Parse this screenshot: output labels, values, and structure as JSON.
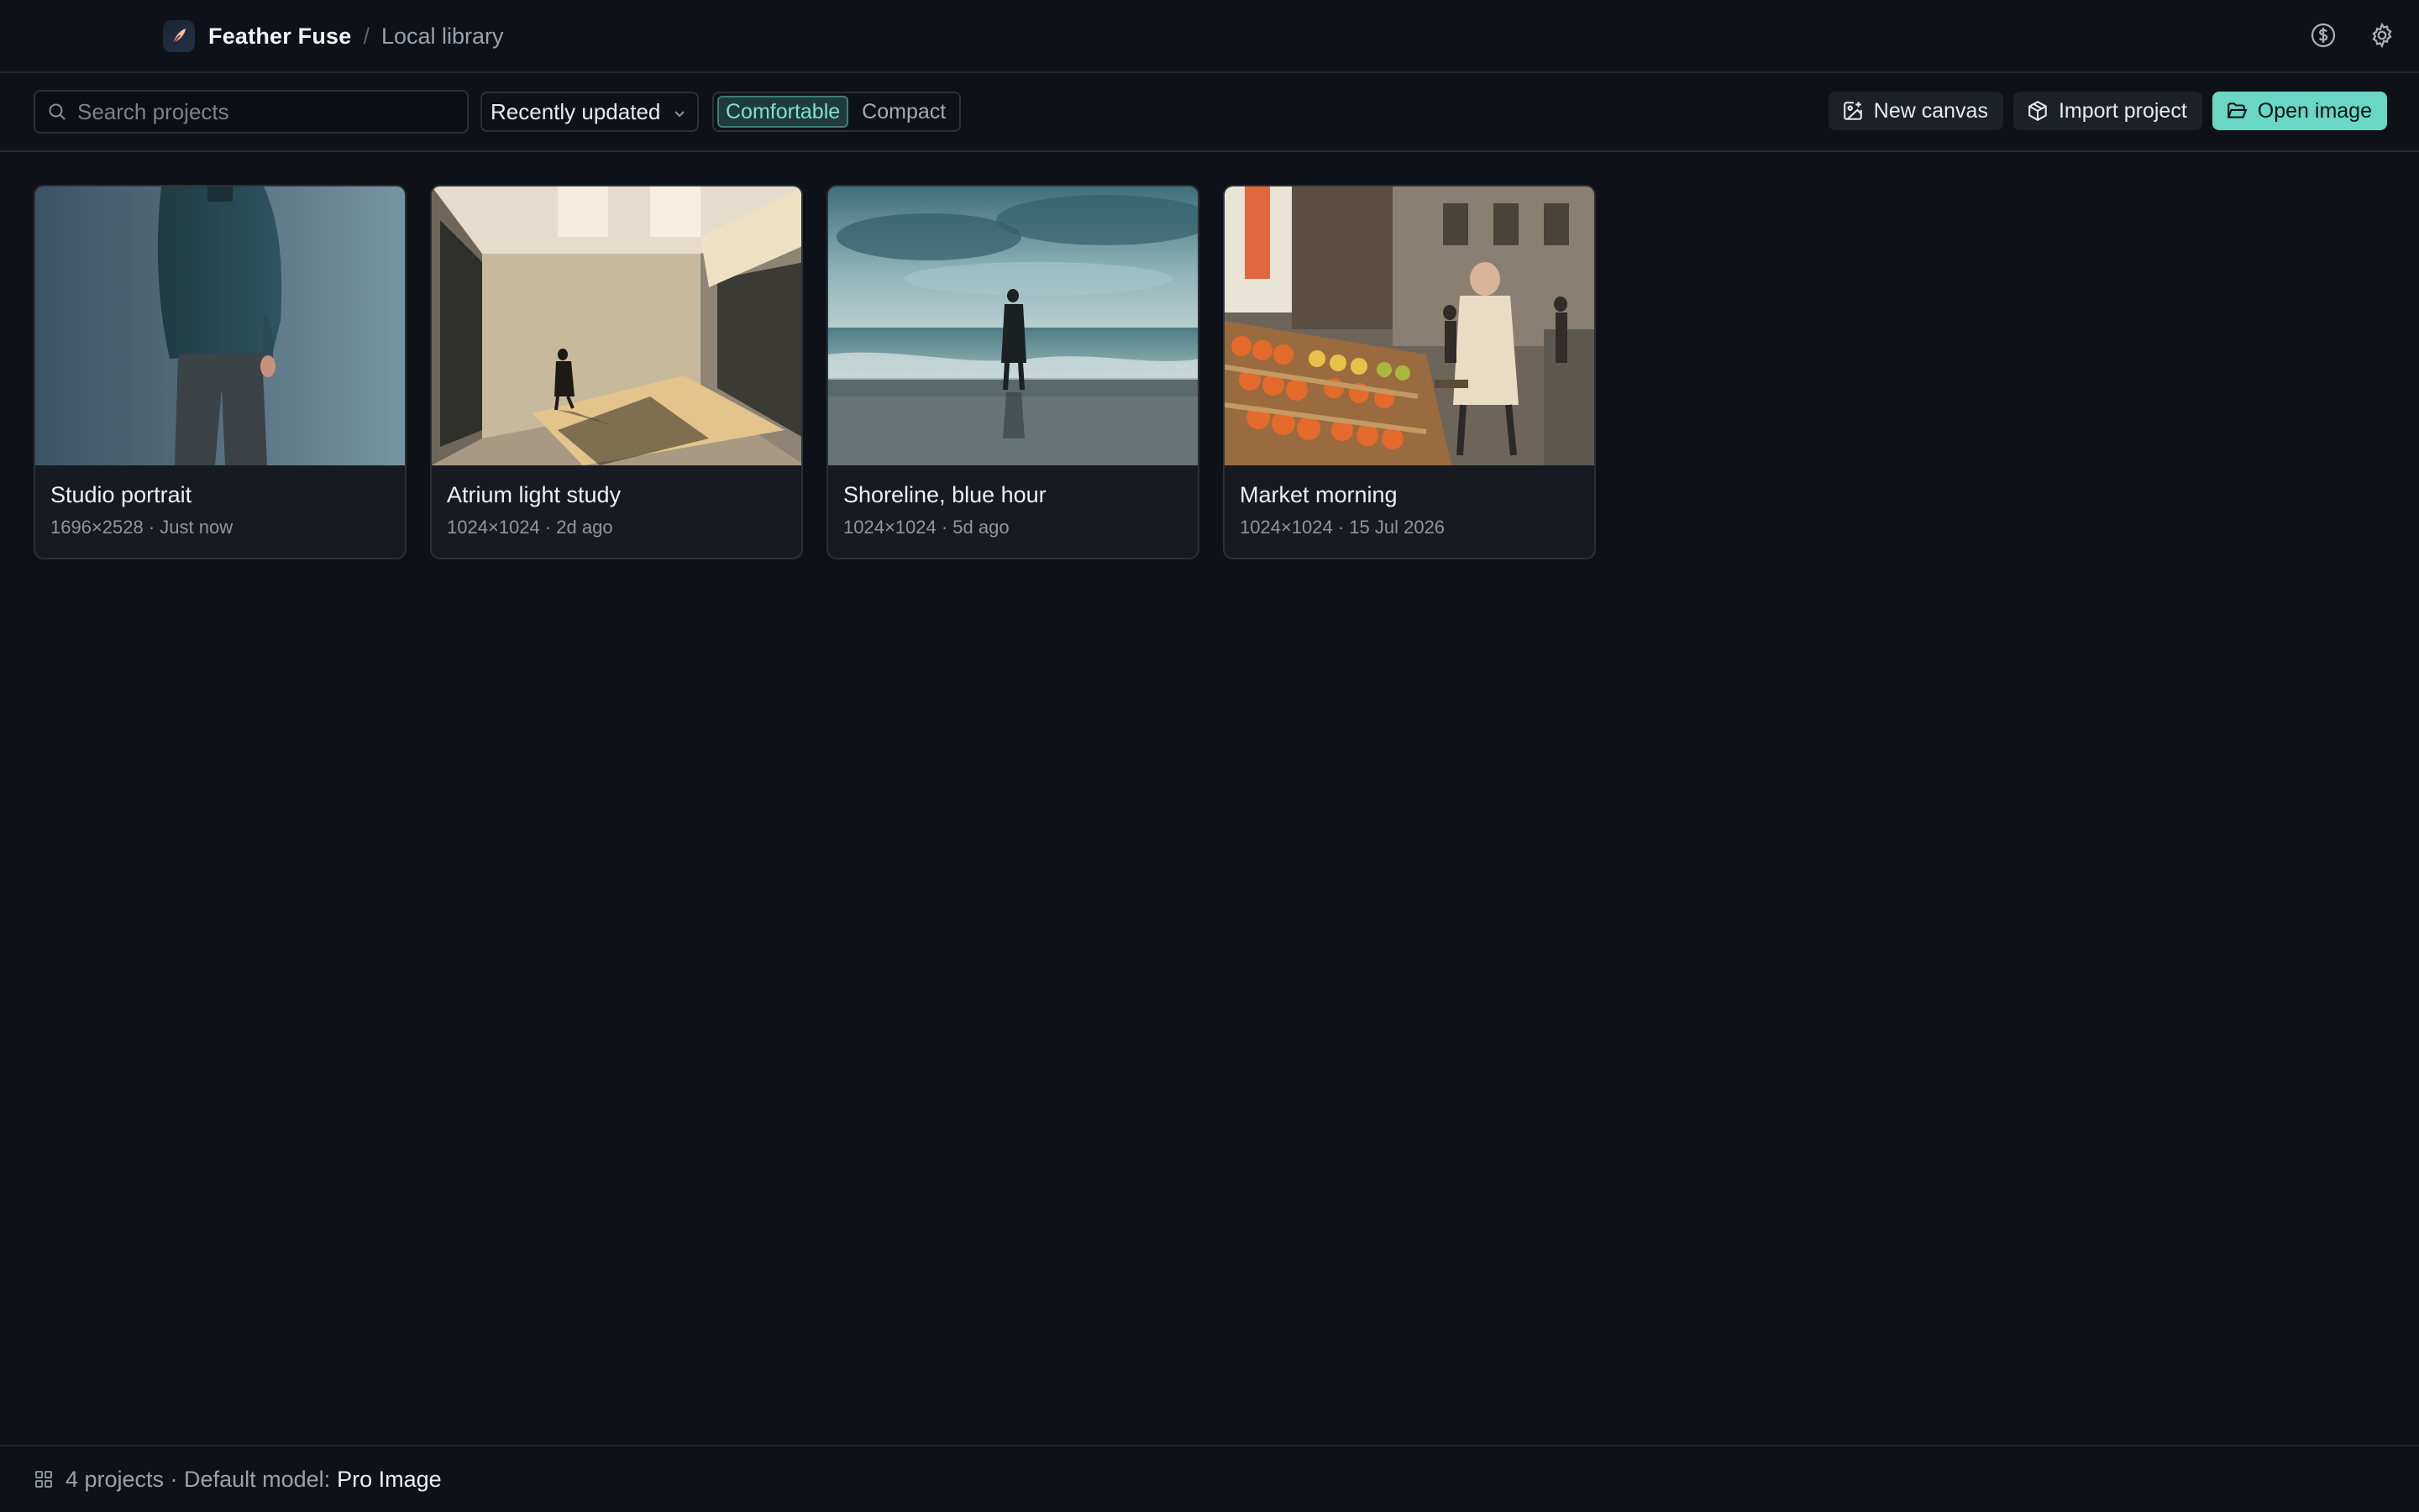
{
  "titlebar": {
    "app_name": "Feather Fuse",
    "separator": "/",
    "breadcrumb": "Local library",
    "icons": [
      "logo-feather-icon",
      "billing-dollar-icon",
      "settings-gear-icon"
    ]
  },
  "toolbar": {
    "search_placeholder": "Search projects",
    "sort_value": "Recently updated",
    "density": {
      "options": [
        "Comfortable",
        "Compact"
      ],
      "selected": "Comfortable"
    },
    "new_canvas_label": "New canvas",
    "import_project_label": "Import project",
    "open_image_label": "Open image"
  },
  "projects": [
    {
      "title": "Studio portrait",
      "meta": "1696×2528 · Just now"
    },
    {
      "title": "Atrium light study",
      "meta": "1024×1024 · 2d ago"
    },
    {
      "title": "Shoreline, blue hour",
      "meta": "1024×1024 · 5d ago"
    },
    {
      "title": "Market morning",
      "meta": "1024×1024 · 15 Jul 2026"
    }
  ],
  "status": {
    "summary": "4 projects · Default model:",
    "model": "Pro Image"
  },
  "colors": {
    "background": "#0e1117",
    "accent": "#69d6c6",
    "card": "#171b21"
  }
}
